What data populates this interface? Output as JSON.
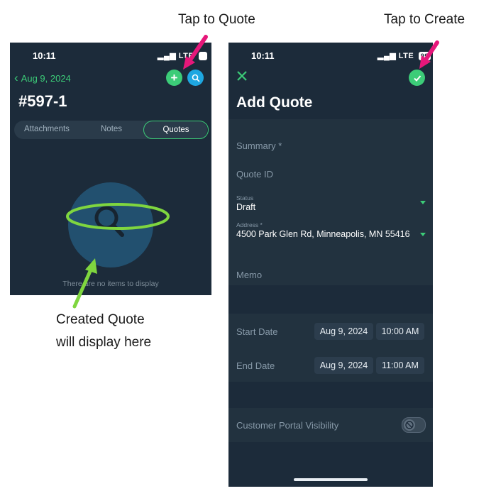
{
  "annotations": {
    "tap_to_quote": "Tap to Quote",
    "tap_to_create": "Tap to Create",
    "created_quote_line1": "Created Quote",
    "created_quote_line2": "will display here"
  },
  "left_screen": {
    "time": "10:11",
    "signal": "LTE",
    "back_label": "Aug 9, 2024",
    "title": "#597-1",
    "tabs": [
      "Attachments",
      "Notes",
      "Quotes"
    ],
    "active_tab": "Quotes",
    "empty_text": "There are no items to display"
  },
  "right_screen": {
    "time": "10:11",
    "signal": "LTE",
    "battery": "99",
    "title": "Add Quote",
    "summary_label": "Summary *",
    "quote_id_label": "Quote ID",
    "status_label": "Status",
    "status_value": "Draft",
    "address_label": "Address *",
    "address_value": "4500 Park Glen Rd, Minneapolis, MN 55416",
    "memo_label": "Memo",
    "start_date_label": "Start Date",
    "start_date": "Aug 9, 2024",
    "start_time": "10:00 AM",
    "end_date_label": "End Date",
    "end_date": "Aug 9, 2024",
    "end_time": "11:00 AM",
    "portal_label": "Customer Portal Visibility"
  },
  "colors": {
    "accent_green": "#3ccc78",
    "search_blue": "#1ea7e1",
    "arrow_pink": "#e6177a",
    "arrow_green": "#7fd63f",
    "bg_dark": "#1c2b3a"
  }
}
